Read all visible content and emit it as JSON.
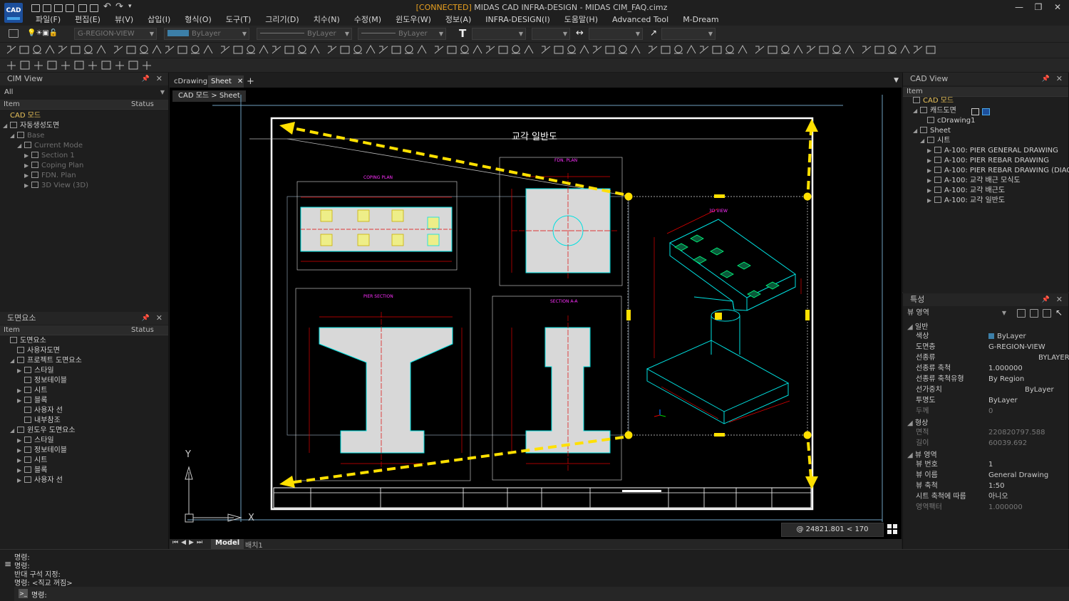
{
  "app": {
    "logo": "CAD",
    "connected": "[CONNECTED]",
    "title": "MIDAS CAD INFRA-DESIGN - MIDAS CIM_FAQ.cimz"
  },
  "menu": [
    "파일(F)",
    "편집(E)",
    "뷰(V)",
    "삽입(I)",
    "형식(O)",
    "도구(T)",
    "그리기(D)",
    "치수(N)",
    "수정(M)",
    "윈도우(W)",
    "정보(A)",
    "INFRA-DESIGN(I)",
    "도움말(H)",
    "Advanced Tool",
    "M-Dream"
  ],
  "toolbar": {
    "layer": "G-REGION-VIEW",
    "color": "ByLayer",
    "linetype": "ByLayer",
    "lineweight": "ByLayer"
  },
  "cim_view": {
    "title": "CIM View",
    "filter": "All",
    "col_item": "Item",
    "col_status": "Status",
    "items": [
      {
        "label": "CAD 모드",
        "level": 0
      },
      {
        "label": "자동생성도면",
        "level": 0
      },
      {
        "label": "Base",
        "level": 1
      },
      {
        "label": "Current Mode",
        "level": 2
      },
      {
        "label": "Section 1",
        "level": 3
      },
      {
        "label": "Coping Plan",
        "level": 3
      },
      {
        "label": "FDN. Plan",
        "level": 3
      },
      {
        "label": "3D View (3D)",
        "level": 3
      }
    ]
  },
  "drawing_elements": {
    "title": "도면요소",
    "col_item": "Item",
    "col_status": "Status",
    "items": [
      {
        "label": "도면요소",
        "level": 0
      },
      {
        "label": "사용자도면",
        "level": 1
      },
      {
        "label": "프로젝트 도면요소",
        "level": 1
      },
      {
        "label": "스타일",
        "level": 2
      },
      {
        "label": "정보테이블",
        "level": 2
      },
      {
        "label": "시트",
        "level": 2
      },
      {
        "label": "블록",
        "level": 2
      },
      {
        "label": "사용자 선",
        "level": 2
      },
      {
        "label": "내부참조",
        "level": 2
      },
      {
        "label": "윈도우 도면요소",
        "level": 1
      },
      {
        "label": "스타일",
        "level": 2
      },
      {
        "label": "정보테이블",
        "level": 2
      },
      {
        "label": "시트",
        "level": 2
      },
      {
        "label": "블록",
        "level": 2
      },
      {
        "label": "사용자 선",
        "level": 2
      }
    ]
  },
  "doc_tabs": [
    "cDrawing1",
    "Sheet"
  ],
  "breadcrumb": "CAD 모드 > Sheet",
  "drawing": {
    "title": "교각 일반도",
    "labels": {
      "coping": "COPING PLAN",
      "fdn": "FDN. PLAN",
      "view3d": "3D VIEW",
      "pier": "PIER SECTION",
      "sectionA": "SECTION A-A"
    }
  },
  "coords": "@ 24821.801 < 170",
  "axis": {
    "y": "Y",
    "x": "X"
  },
  "layout_tabs": [
    "Model",
    "배치1"
  ],
  "command_lines": [
    "명령:",
    "명령:",
    "반대 구석 지정:",
    "명령: <직교 꺼짐>"
  ],
  "command_prompt": "명령:",
  "cad_view": {
    "title": "CAD View",
    "col_item": "Item",
    "items": [
      {
        "label": "CAD 모드",
        "level": 0
      },
      {
        "label": "캐드도면",
        "level": 1
      },
      {
        "label": "cDrawing1",
        "level": 2
      },
      {
        "label": "Sheet",
        "level": 1
      },
      {
        "label": "시트",
        "level": 2
      },
      {
        "label": "A-100: PIER GENERAL DRAWING",
        "level": 3
      },
      {
        "label": "A-100: PIER REBAR DRAWING",
        "level": 3
      },
      {
        "label": "A-100: PIER REBAR DRAWING (DIAG...",
        "level": 3
      },
      {
        "label": "A-100: 교각 배근 모식도",
        "level": 3
      },
      {
        "label": "A-100: 교각 배근도",
        "level": 3
      },
      {
        "label": "A-100: 교각 일반도",
        "level": 3
      }
    ]
  },
  "properties": {
    "title": "특성",
    "type": "뷰 영역",
    "sections": [
      {
        "name": "일반",
        "rows": [
          {
            "k": "색상",
            "v": "ByLayer"
          },
          {
            "k": "도면층",
            "v": "G-REGION-VIEW"
          },
          {
            "k": "선종류",
            "v": "BYLAYER"
          },
          {
            "k": "선종류 축척",
            "v": "1.000000"
          },
          {
            "k": "선종류 축척유형",
            "v": "By Region"
          },
          {
            "k": "선가중치",
            "v": "ByLayer"
          },
          {
            "k": "투명도",
            "v": "ByLayer"
          },
          {
            "k": "두께",
            "v": "0"
          }
        ]
      },
      {
        "name": "형상",
        "rows": [
          {
            "k": "면적",
            "v": "220820797.588"
          },
          {
            "k": "길이",
            "v": "60039.692"
          }
        ]
      },
      {
        "name": "뷰 영역",
        "rows": [
          {
            "k": "뷰 번호",
            "v": "1"
          },
          {
            "k": "뷰 이름",
            "v": "General Drawing"
          },
          {
            "k": "뷰 축척",
            "v": "1:50"
          },
          {
            "k": "시트 축척에 따름",
            "v": "아니오"
          },
          {
            "k": "영역팩터",
            "v": "1.000000"
          }
        ]
      }
    ]
  },
  "colors": {
    "accent_yellow": "#ffe000",
    "canvas": "#000000",
    "cyan": "#00e0e0",
    "red": "#e00000",
    "magenta": "#ff30ff",
    "gold": "#e9c25a"
  }
}
